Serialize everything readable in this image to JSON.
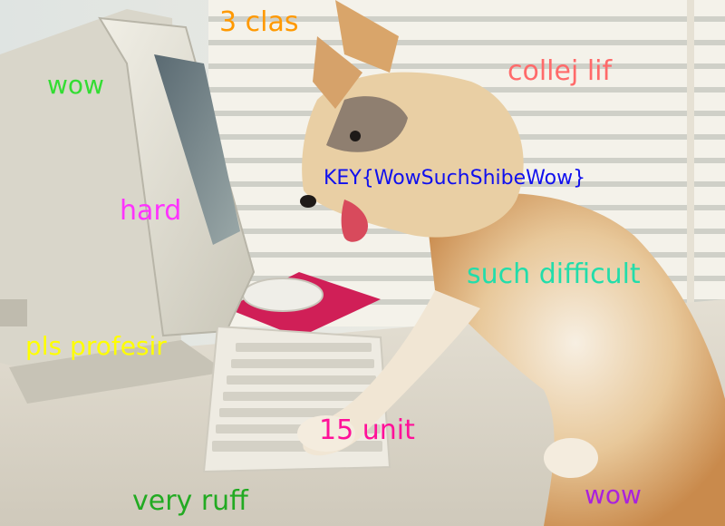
{
  "captions": {
    "c1": {
      "text": "3 clas",
      "color": "#ff9900"
    },
    "c2": {
      "text": "wow",
      "color": "#33dd33"
    },
    "c3": {
      "text": "collej lif",
      "color": "#ff6a6a"
    },
    "c4": {
      "text": "KEY{WowSuchShibeWow}",
      "color": "#1010ee"
    },
    "c5": {
      "text": "hard",
      "color": "#ff33ff"
    },
    "c6": {
      "text": "such difficult",
      "color": "#22ddaa"
    },
    "c7": {
      "text": "pls profesir",
      "color": "#ffff00"
    },
    "c8": {
      "text": "15 unit",
      "color": "#ff1199"
    },
    "c9": {
      "text": "very ruff",
      "color": "#22aa22"
    },
    "c10": {
      "text": "wow",
      "color": "#aa22dd"
    }
  },
  "scene": {
    "subject": "shiba-inu-puppy",
    "objects": [
      "crt-monitor",
      "keyboard",
      "computer-mouse",
      "mouse-pad",
      "window-blinds",
      "desk"
    ]
  }
}
